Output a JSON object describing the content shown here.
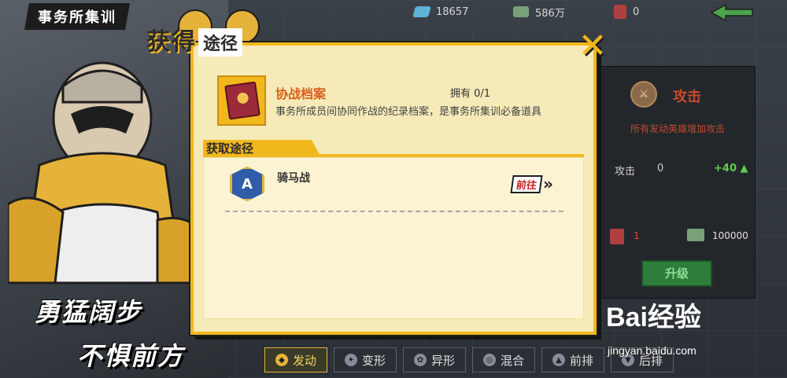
{
  "panel": {
    "title": "事务所集训"
  },
  "slogan": {
    "line1": "勇猛阔步",
    "line2": "不惧前方"
  },
  "currency": {
    "gems": "18657",
    "cash": "586万",
    "books": "0"
  },
  "modal": {
    "title_a": "获得",
    "title_b": "途径",
    "close": "✕",
    "item_name": "协战档案",
    "item_owned": "拥有 0/1",
    "item_desc": "事务所成员间协同作战的纪录档案，是事务所集训必备道具",
    "source_header": "获取途径",
    "sources": [
      {
        "badge": "A",
        "name": "骑马战",
        "go": "前往",
        "arrow": "»"
      }
    ]
  },
  "attack": {
    "title": "攻击",
    "desc": "所有发动英雄增加攻击",
    "stat_label": "攻击",
    "stat_value": "0",
    "stat_increase": "+40",
    "cost_book": "1",
    "cost_cash": "100000",
    "upgrade": "升级"
  },
  "tabs": [
    {
      "label": "发动",
      "active": true
    },
    {
      "label": "变形",
      "active": false
    },
    {
      "label": "异形",
      "active": false
    },
    {
      "label": "混合",
      "active": false
    },
    {
      "label": "前排",
      "active": false
    },
    {
      "label": "后排",
      "active": false
    }
  ],
  "watermark": {
    "text": "Bai经验",
    "url": "jingyan.baidu.com"
  }
}
